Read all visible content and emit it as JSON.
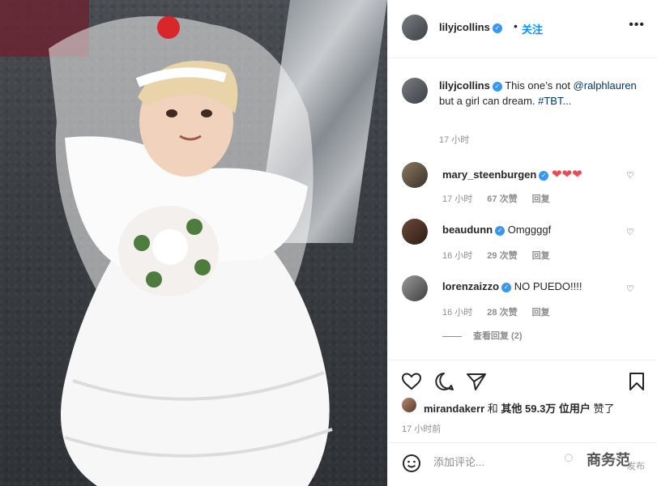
{
  "post": {
    "image_alt": "photo"
  },
  "header": {
    "username": "lilyjcollins",
    "separator": "•",
    "follow_label": "关注",
    "more": "•••"
  },
  "caption": {
    "username": "lilyjcollins",
    "text_before": " This one’s not ",
    "mention": "@ralphlauren",
    "text_after": " but a girl can dream. ",
    "hashtag": "#TBT...",
    "time": "17 小时"
  },
  "comments": [
    {
      "username": "mary_steenburgen",
      "text": "❤❤❤",
      "time": "17 小时",
      "likes": "67 次赞",
      "reply": "回复"
    },
    {
      "username": "beaudunn",
      "text": "Omggggf",
      "time": "16 小时",
      "likes": "29 次赞",
      "reply": "回复"
    },
    {
      "username": "lorenzaizzo",
      "text": "NO PUEDO!!!!",
      "time": "16 小时",
      "likes": "28 次赞",
      "reply": "回复"
    }
  ],
  "view_replies": "查看回复 (2)",
  "likes_line": {
    "user": "mirandakerr",
    "joiner": " 和 ",
    "others": "其他 59.3万 位用户",
    "suffix": " 赞了"
  },
  "time_ago": "17 小时前",
  "comment_box": {
    "placeholder": "添加评论..."
  },
  "watermark": {
    "text": "商务范",
    "sub": "发布"
  },
  "icons": {
    "verified": "verified-badge-icon",
    "heart": "heart-icon",
    "comment": "comment-icon",
    "share": "share-icon",
    "bookmark": "bookmark-icon",
    "emoji": "emoji-icon"
  },
  "colors": {
    "accent": "#0095f6",
    "verified": "#3897f0",
    "like_red": "#ed4956",
    "muted": "#8e8e8e"
  }
}
